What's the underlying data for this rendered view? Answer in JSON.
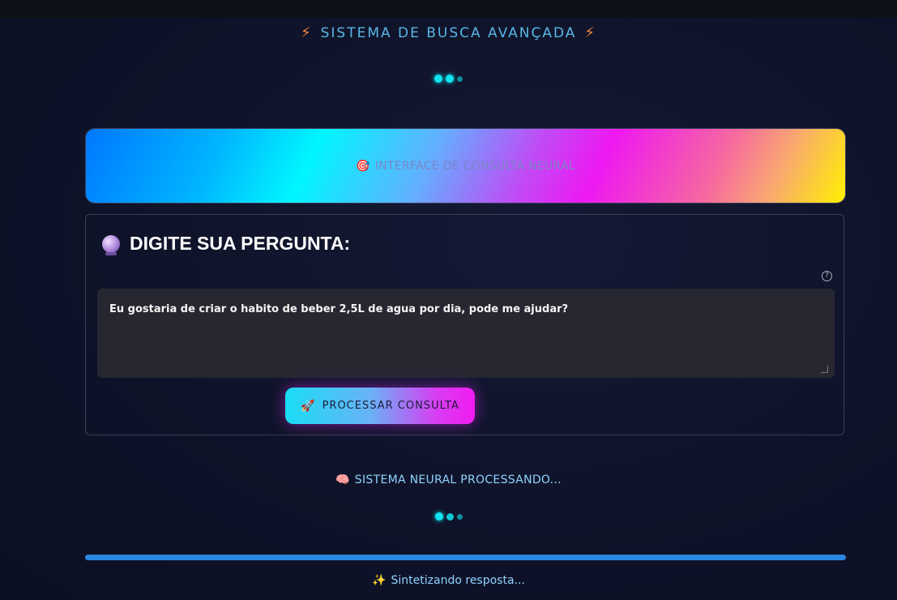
{
  "header": {
    "title": "SISTEMA DE BUSCA AVANÇADA",
    "left_icon": "⚡",
    "right_icon": "⚡"
  },
  "banner": {
    "icon": "🎯",
    "text": "INTERFACE DE CONSULTA NEURAL"
  },
  "question_card": {
    "heading": "DIGITE SUA PERGUNTA:",
    "help_icon": "?",
    "input_value": "Eu gostaria de criar o habito de beber 2,5L de agua por dia, pode me ajudar?",
    "button_icon": "🚀",
    "button_label": "PROCESSAR CONSULTA"
  },
  "status": {
    "neural_icon": "🧠",
    "neural_text": "SISTEMA NEURAL PROCESSANDO...",
    "progress": 1.0,
    "synth_icon": "✨",
    "synth_text": "Sintetizando resposta..."
  },
  "colors": {
    "accent_cyan": "#12e4f2",
    "accent_magenta": "#f01cf0",
    "progress_blue": "#2a86e0",
    "status_text": "#8fd3ff"
  }
}
